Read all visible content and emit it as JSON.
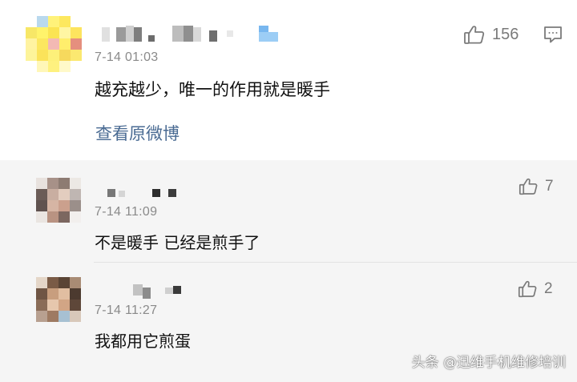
{
  "main_comment": {
    "timestamp": "7-14 01:03",
    "text": "越充越少，唯一的作用就是暖手",
    "like_count": "156",
    "view_original_link": "查看原微博",
    "icons": {
      "like": "thumbs-up-icon",
      "reply": "comment-icon"
    }
  },
  "replies": [
    {
      "timestamp": "7-14 11:09",
      "text": "不是暖手 已经是煎手了",
      "like_count": "7"
    },
    {
      "timestamp": "7-14 11:27",
      "text": "我都用它煎蛋",
      "like_count": "2"
    }
  ],
  "watermark": "头条 @迅维手机维修培训",
  "colors": {
    "link": "#4a6b93",
    "timestamp": "#8a8a8a",
    "reply_background": "#f5f5f5",
    "icon_gray": "#7a7a7a"
  }
}
